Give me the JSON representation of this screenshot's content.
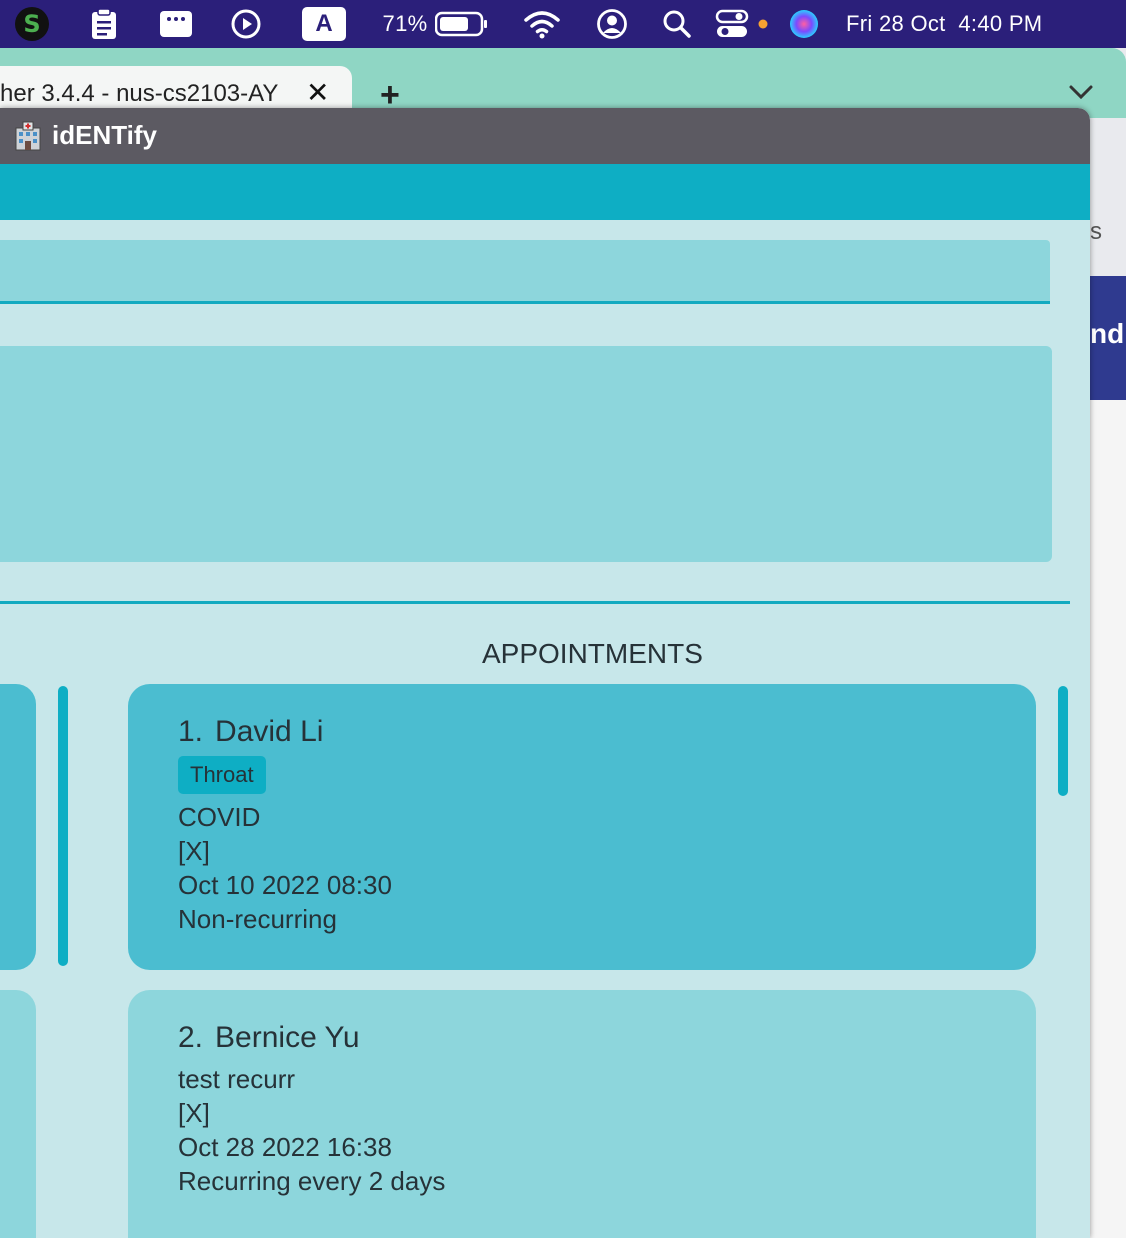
{
  "menubar": {
    "battery_percent": "71%",
    "datetime": "Fri 28 Oct  4:40 PM",
    "input_source": "A",
    "icons": [
      "scrivener-icon",
      "clipboard-icon",
      "window-icon",
      "play-icon",
      "input-source-icon",
      "battery-icon",
      "wifi-icon",
      "user-icon",
      "search-icon",
      "control-center-icon",
      "siri-icon"
    ],
    "accent_color": "#2b1f7a"
  },
  "browser": {
    "tab_title": "her 3.4.4 - nus-cs2103-AY",
    "tab_close": "✕",
    "new_tab": "+",
    "side_fragment_top": "s",
    "side_fragment_banner": "nd"
  },
  "app": {
    "title": "idENTify",
    "icon": "hospital-icon",
    "accent_color": "#0eaec4",
    "background_color": "#c7e7ea"
  },
  "appointments": {
    "heading": "APPOINTMENTS",
    "items": [
      {
        "index": "1.",
        "name": "David Li",
        "tag": "Throat",
        "reason": "COVID",
        "status": "[X]",
        "datetime": "Oct 10 2022 08:30",
        "recurrence": "Non-recurring"
      },
      {
        "index": "2.",
        "name": "Bernice Yu",
        "reason": "test recurr",
        "status": "[X]",
        "datetime": "Oct 28 2022 16:38",
        "recurrence": "Recurring every 2 days"
      }
    ]
  }
}
